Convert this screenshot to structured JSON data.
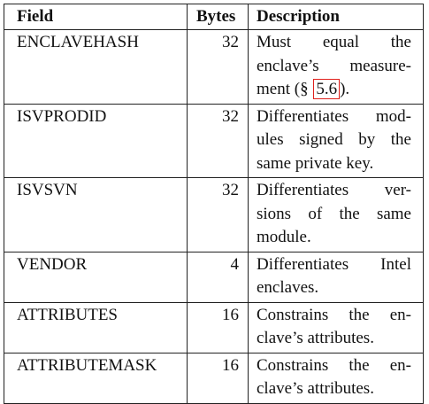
{
  "table": {
    "headers": {
      "field": "Field",
      "bytes": "Bytes",
      "description": "Description"
    },
    "rows": [
      {
        "field": "ENCLAVEHASH",
        "bytes": "32",
        "desc_lines": [
          "Must equal the",
          "enclave’s measure-",
          "ment (§ ",
          "5.6",
          ")."
        ]
      },
      {
        "field": "ISVPRODID",
        "bytes": "32",
        "desc_lines": [
          "Differentiates mod-",
          "ules signed by the",
          "same private key."
        ]
      },
      {
        "field": "ISVSVN",
        "bytes": "32",
        "desc_lines": [
          "Differentiates ver-",
          "sions of the same",
          "module."
        ]
      },
      {
        "field": "VENDOR",
        "bytes": "4",
        "desc_lines": [
          "Differentiates Intel",
          "enclaves."
        ]
      },
      {
        "field": "ATTRIBUTES",
        "bytes": "16",
        "desc_lines": [
          "Constrains the en-",
          "clave’s attributes."
        ]
      },
      {
        "field": "ATTRIBUTEMASK",
        "bytes": "16",
        "desc_lines": [
          "Constrains the en-",
          "clave’s attributes."
        ]
      }
    ]
  },
  "colors": {
    "reference_box": "#e0201c"
  }
}
